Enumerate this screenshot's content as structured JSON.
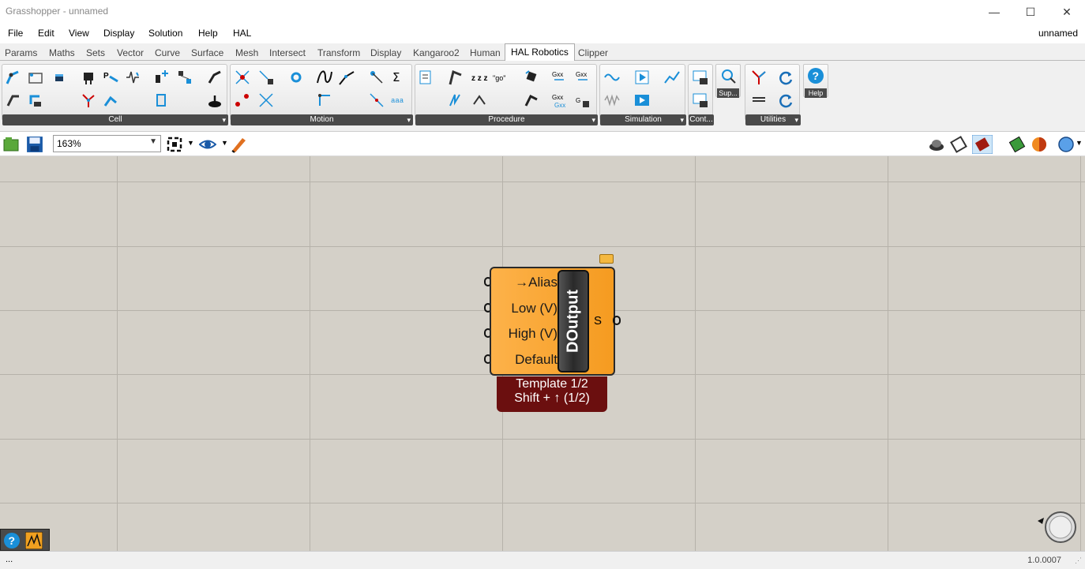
{
  "window": {
    "title": "Grasshopper - unnamed",
    "minimize": "—",
    "maximize": "☐",
    "close": "✕"
  },
  "menu": {
    "items": [
      "File",
      "Edit",
      "View",
      "Display",
      "Solution",
      "Help",
      "HAL"
    ],
    "document_name": "unnamed"
  },
  "tabs": [
    "Params",
    "Maths",
    "Sets",
    "Vector",
    "Curve",
    "Surface",
    "Mesh",
    "Intersect",
    "Transform",
    "Display",
    "Kangaroo2",
    "Human",
    "HAL Robotics",
    "Clipper"
  ],
  "active_tab": "HAL Robotics",
  "ribbon": {
    "panels": [
      "Cell",
      "Motion",
      "Procedure",
      "Simulation"
    ],
    "small_panels": [
      "Cont...",
      "Sup...",
      "Help"
    ],
    "utilities": "Utilities"
  },
  "canvas_toolbar": {
    "zoom": "163%"
  },
  "component": {
    "name": "DOutput",
    "inputs": [
      "→Alias",
      "Low (V)",
      "High (V)",
      "Default"
    ],
    "output": "S",
    "tooltip_line1": "Template 1/2",
    "tooltip_line2": "Shift + ↑ (1/2)"
  },
  "statusbar": {
    "text": "...",
    "version": "1.0.0007"
  },
  "colors": {
    "component": "#f7a12a",
    "tooltip": "#6b0f0f",
    "canvas": "#d4d0c8",
    "accent_blue": "#1a8fd8"
  }
}
